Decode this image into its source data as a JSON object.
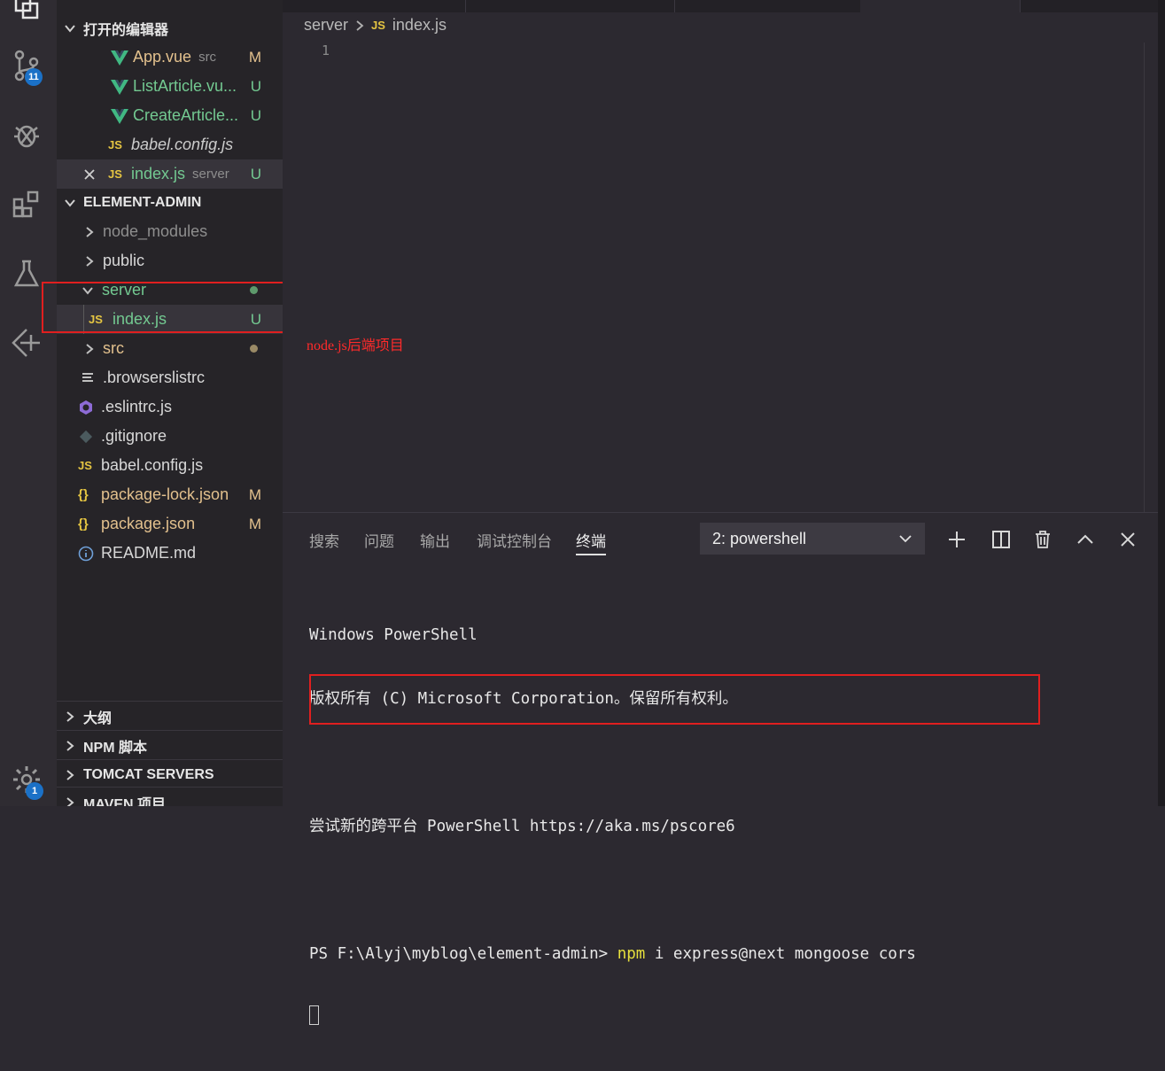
{
  "activity_bar": {
    "icons": [
      "explorer-icon",
      "source-control-icon",
      "debug-icon",
      "extensions-icon",
      "testing-icon",
      "remote-icon",
      "settings-gear-icon"
    ],
    "source_control_badge": "11",
    "settings_badge": "1",
    "badge_color": "#1b71c7"
  },
  "sidebar": {
    "open_editors_header": "打开的编辑器",
    "open_editors": [
      {
        "icon": "vue",
        "name": "App.vue",
        "desc": "src",
        "status": "M",
        "color": "#e2c08d"
      },
      {
        "icon": "vue",
        "name": "ListArticle.vu...",
        "desc": "",
        "status": "U",
        "color": "#73c991"
      },
      {
        "icon": "vue",
        "name": "CreateArticle...",
        "desc": "",
        "status": "U",
        "color": "#73c991"
      },
      {
        "icon": "js",
        "name": "babel.config.js",
        "desc": "",
        "status": "",
        "color": "#cccccc"
      },
      {
        "icon": "js",
        "name": "index.js",
        "desc": "server",
        "status": "U",
        "color": "#73c991"
      }
    ],
    "project_header": "ELEMENT-ADMIN",
    "tree": {
      "node_modules": "node_modules",
      "public": "public",
      "server": "server",
      "server_index": "index.js",
      "server_index_status": "U",
      "src": "src",
      "browserslistrc": ".browserslistrc",
      "eslintrc": ".eslintrc.js",
      "gitignore": ".gitignore",
      "babel": "babel.config.js",
      "package_lock": "package-lock.json",
      "package_lock_status": "M",
      "package_json": "package.json",
      "package_json_status": "M",
      "readme": "README.md"
    },
    "bottom_sections": [
      "大纲",
      "NPM 脚本",
      "TOMCAT SERVERS",
      "MAVEN 项目"
    ]
  },
  "editor": {
    "breadcrumb_folder": "server",
    "breadcrumb_file": "index.js",
    "line_number": "1",
    "annotation": "node.js后端项目"
  },
  "panel": {
    "tabs": [
      "搜索",
      "问题",
      "输出",
      "调试控制台",
      "终端"
    ],
    "active_tab": "终端",
    "terminal_select": "2: powershell",
    "terminal_lines": {
      "l1": "Windows PowerShell",
      "l2": "版权所有 (C) Microsoft Corporation。保留所有权利。",
      "l3": "尝试新的跨平台 PowerShell https://aka.ms/pscore6",
      "prompt": "PS F:\\Alyj\\myblog\\element-admin> ",
      "cmd_npm": "npm",
      "cmd_rest": " i express@next mongoose cors"
    }
  },
  "colors": {
    "untracked_green": "#73c991",
    "modified_yellow": "#e2c08d",
    "highlight_red": "#e01f1f",
    "npm_yellow": "#e6df3d"
  }
}
